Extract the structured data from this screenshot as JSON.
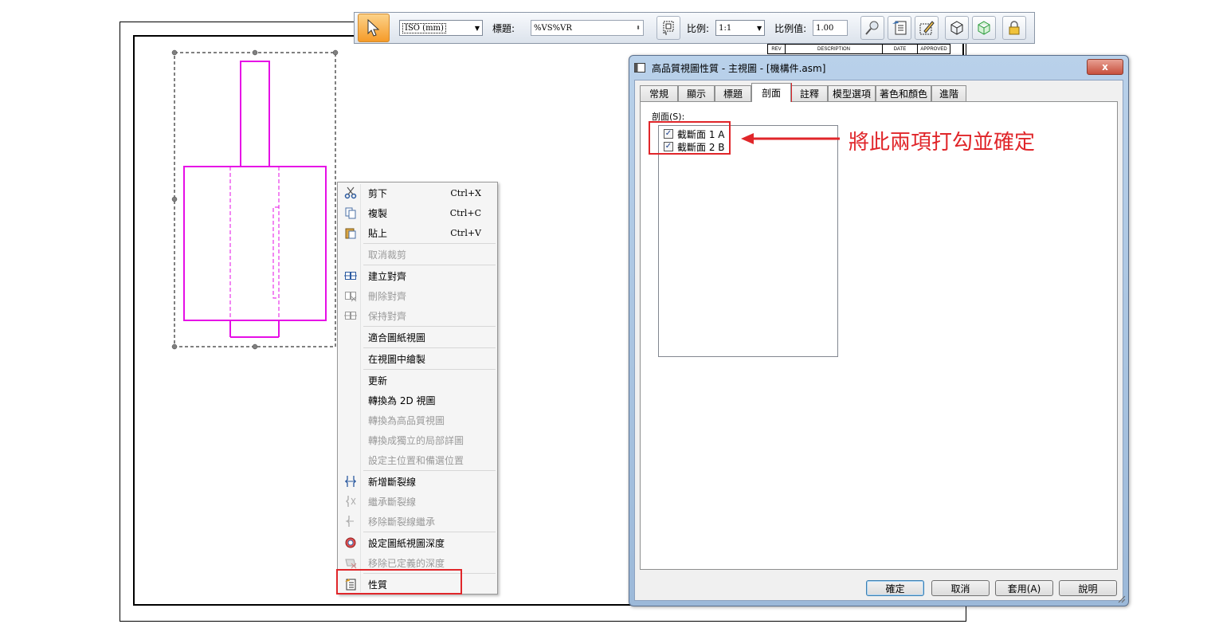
{
  "toolbar": {
    "standard_value": "ISO (mm)",
    "caption_label": "標題:",
    "caption_value": "%VS%VR",
    "scale_label": "比例:",
    "scale_value": "1:1",
    "scale_factor_label": "比例值:",
    "scale_factor_value": "1.00"
  },
  "title_block": [
    "REV",
    "DESCRIPTION",
    "DATE",
    "APPROVED"
  ],
  "context_menu": {
    "items": [
      {
        "label": "剪下",
        "shortcut": "Ctrl+X",
        "icon": "scissors-icon",
        "enabled": true
      },
      {
        "label": "複製",
        "shortcut": "Ctrl+C",
        "icon": "copy-icon",
        "enabled": true
      },
      {
        "label": "貼上",
        "shortcut": "Ctrl+V",
        "icon": "paste-icon",
        "enabled": true
      },
      {
        "label": "取消裁剪",
        "shortcut": "",
        "icon": "",
        "enabled": false
      },
      {
        "label": "建立對齊",
        "shortcut": "",
        "icon": "create-alignment-icon",
        "enabled": true
      },
      {
        "label": "刪除對齊",
        "shortcut": "",
        "icon": "delete-alignment-icon",
        "enabled": false
      },
      {
        "label": "保持對齊",
        "shortcut": "",
        "icon": "maintain-alignment-icon",
        "enabled": false
      },
      {
        "label": "適合圖紙視圖",
        "shortcut": "",
        "icon": "",
        "enabled": true
      },
      {
        "label": "在視圖中繪製",
        "shortcut": "",
        "icon": "",
        "enabled": true
      },
      {
        "label": "更新",
        "shortcut": "",
        "icon": "",
        "enabled": true
      },
      {
        "label": "轉換為 2D 視圖",
        "shortcut": "",
        "icon": "",
        "enabled": true
      },
      {
        "label": "轉換為高品質視圖",
        "shortcut": "",
        "icon": "",
        "enabled": false
      },
      {
        "label": "轉換成獨立的局部詳圖",
        "shortcut": "",
        "icon": "",
        "enabled": false
      },
      {
        "label": "設定主位置和備選位置",
        "shortcut": "",
        "icon": "",
        "enabled": false
      },
      {
        "label": "新增斷裂線",
        "shortcut": "",
        "icon": "add-break-line-icon",
        "enabled": true
      },
      {
        "label": "繼承斷裂線",
        "shortcut": "",
        "icon": "inherit-break-line-icon",
        "enabled": false
      },
      {
        "label": "移除斷裂線繼承",
        "shortcut": "",
        "icon": "remove-break-inheritance-icon",
        "enabled": false
      },
      {
        "label": "設定圖紙視圖深度",
        "shortcut": "",
        "icon": "set-view-depth-icon",
        "enabled": true
      },
      {
        "label": "移除已定義的深度",
        "shortcut": "",
        "icon": "remove-depth-icon",
        "enabled": false
      },
      {
        "label": "性質",
        "shortcut": "",
        "icon": "properties-icon",
        "enabled": true
      }
    ]
  },
  "dialog": {
    "title": "高品質視圖性質 - 主視圖 - [機構件.asm]",
    "close_label": "x",
    "tabs": [
      "常規",
      "顯示",
      "標題",
      "剖面",
      "註釋",
      "模型選項",
      "著色和顏色",
      "進階"
    ],
    "selected_tab": "剖面",
    "sections_label": "剖面(S):",
    "sections": [
      {
        "label": "截斷面 1 A",
        "checked": true
      },
      {
        "label": "截斷面 2 B",
        "checked": true
      }
    ],
    "buttons": {
      "ok": "確定",
      "cancel": "取消",
      "apply": "套用(A)",
      "help": "說明"
    }
  },
  "annotation": {
    "text": "將此兩項打勾並確定",
    "color": "#e0262a"
  },
  "colors": {
    "highlight": "#e0262a",
    "drawing_line": "#e60ee6",
    "active_tool": "#f59b29"
  }
}
